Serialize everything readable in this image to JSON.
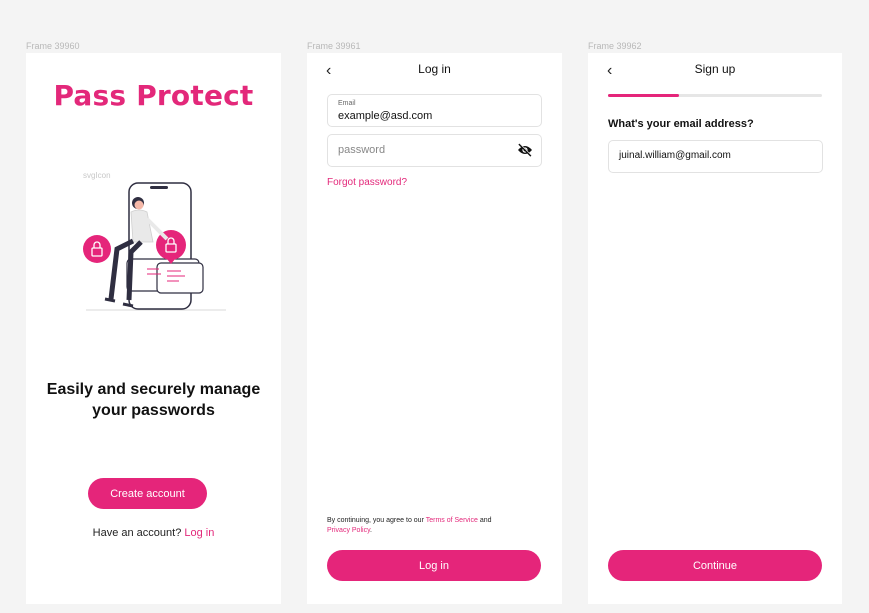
{
  "frames": {
    "f1_label": "Frame 39960",
    "f2_label": "Frame 39961",
    "f3_label": "Frame 39962"
  },
  "welcome": {
    "logo": "Pass Protect",
    "svgicon_label": "svgIcon",
    "tagline_line1": "Easily and securely manage",
    "tagline_line2": "your passwords",
    "create_account": "Create account",
    "have_account": "Have an account?",
    "login_link": "Log in"
  },
  "login": {
    "title": "Log in",
    "back_icon": "chevron-left-icon",
    "email_label": "Email",
    "email_value": "example@asd.com",
    "password_placeholder": "password",
    "eye_icon": "eye-off-icon",
    "forgot": "Forgot password?",
    "terms_prefix": "By continuing, you agree to our",
    "terms_link": "Terms of Service",
    "terms_and": "and",
    "privacy_link": "Privacy Policy",
    "terms_suffix": ".",
    "button": "Log in"
  },
  "signup": {
    "title": "Sign up",
    "back_icon": "chevron-left-icon",
    "progress": 0.33,
    "question": "What's your email address?",
    "email_value": "juinal.william@gmail.com",
    "button": "Continue"
  },
  "colors": {
    "accent": "#e5257a",
    "background": "#f4f4f4"
  }
}
